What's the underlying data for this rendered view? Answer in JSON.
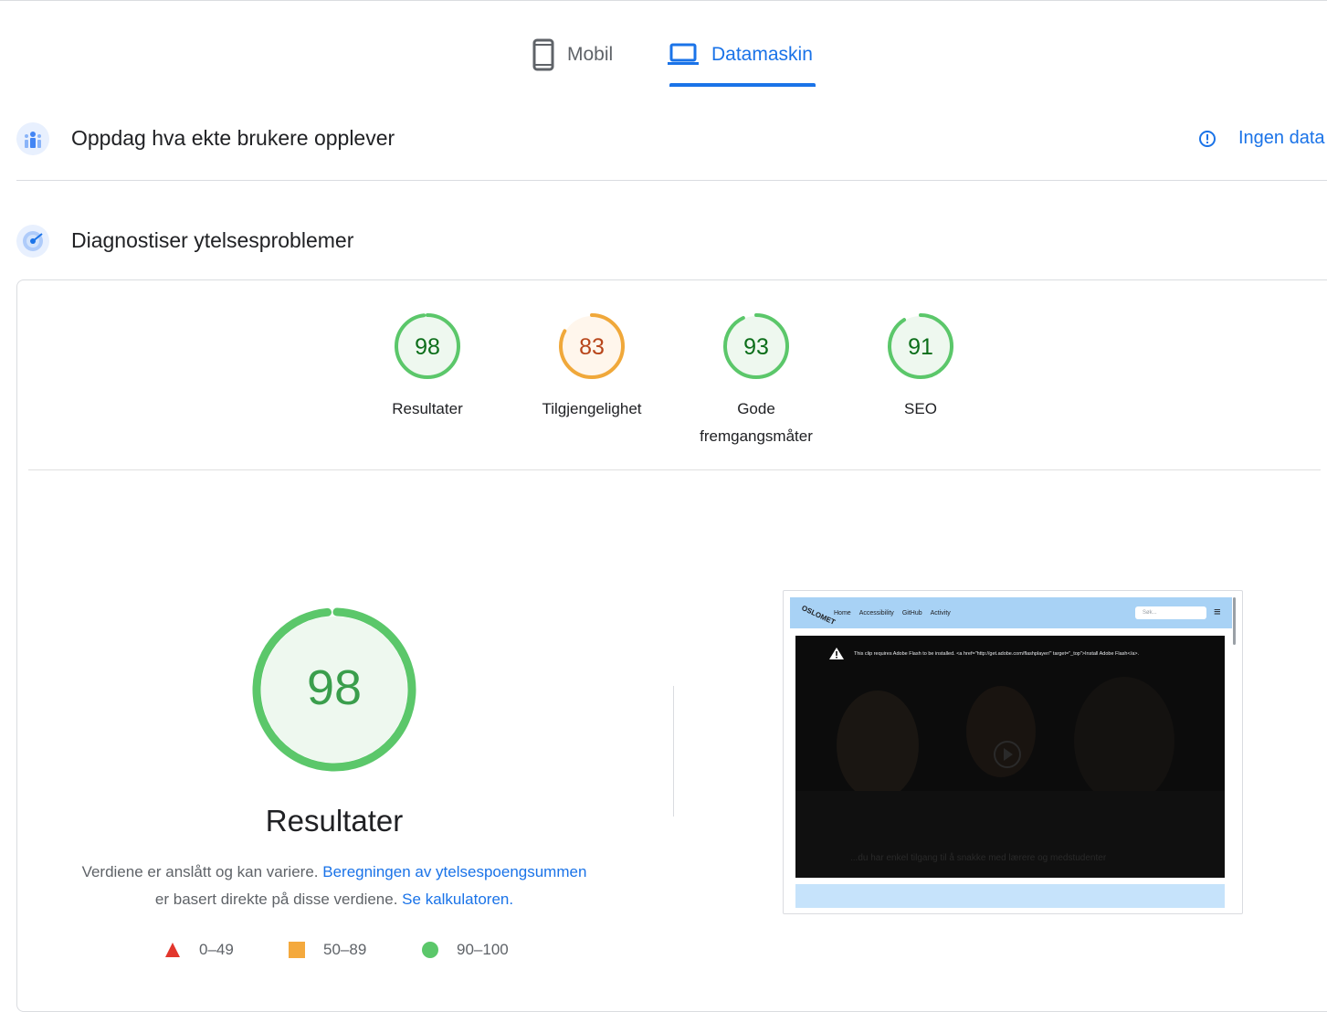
{
  "tabs": {
    "mobile_label": "Mobil",
    "desktop_label": "Datamaskin",
    "active": "Datamaskin"
  },
  "field_data": {
    "title": "Oppdag hva ekte brukere opplever",
    "no_data_label": "Ingen data"
  },
  "lab_data": {
    "title": "Diagnostiser ytelsesproblemer"
  },
  "gauges": [
    {
      "label": "Resultater",
      "score": "98",
      "value": 0.98,
      "color": "#0c6e1a",
      "ring": "#5bc76a",
      "bg": "#eef8ef"
    },
    {
      "label": "Tilgjengelighet",
      "score": "83",
      "value": 0.83,
      "color": "#b8451a",
      "ring": "#f0a83a",
      "bg": "#fff6ec"
    },
    {
      "label_line1": "Gode",
      "label_line2": "fremgangsmåter",
      "score": "93",
      "value": 0.93,
      "color": "#0c6e1a",
      "ring": "#5bc76a",
      "bg": "#eef8ef"
    },
    {
      "label": "SEO",
      "score": "91",
      "value": 0.91,
      "color": "#0c6e1a",
      "ring": "#5bc76a",
      "bg": "#eef8ef"
    }
  ],
  "main_score": {
    "score": "98",
    "value": 0.98,
    "title": "Resultater",
    "desc_part1": "Verdiene er anslått og kan variere. ",
    "desc_link1": "Beregningen av ytelsespoengsummen",
    "desc_part2": "er basert direkte på disse verdiene. ",
    "desc_link2": "Se kalkulatoren."
  },
  "legend": {
    "fail": "0–49",
    "average": "50–89",
    "pass": "90–100"
  },
  "thumbnail": {
    "nav_links": [
      "Home",
      "Accessibility",
      "GitHub",
      "Activity"
    ],
    "search_placeholder": "Søk...",
    "warning_text": "This clip requires Adobe Flash to be installed. <a href=\"http://get.adobe.com/flashplayer/\" target=\"_top\">Install Adobe Flash</a>.",
    "caption": "...du har enkel tilgang til å snakke med lærere og medstudenter"
  }
}
